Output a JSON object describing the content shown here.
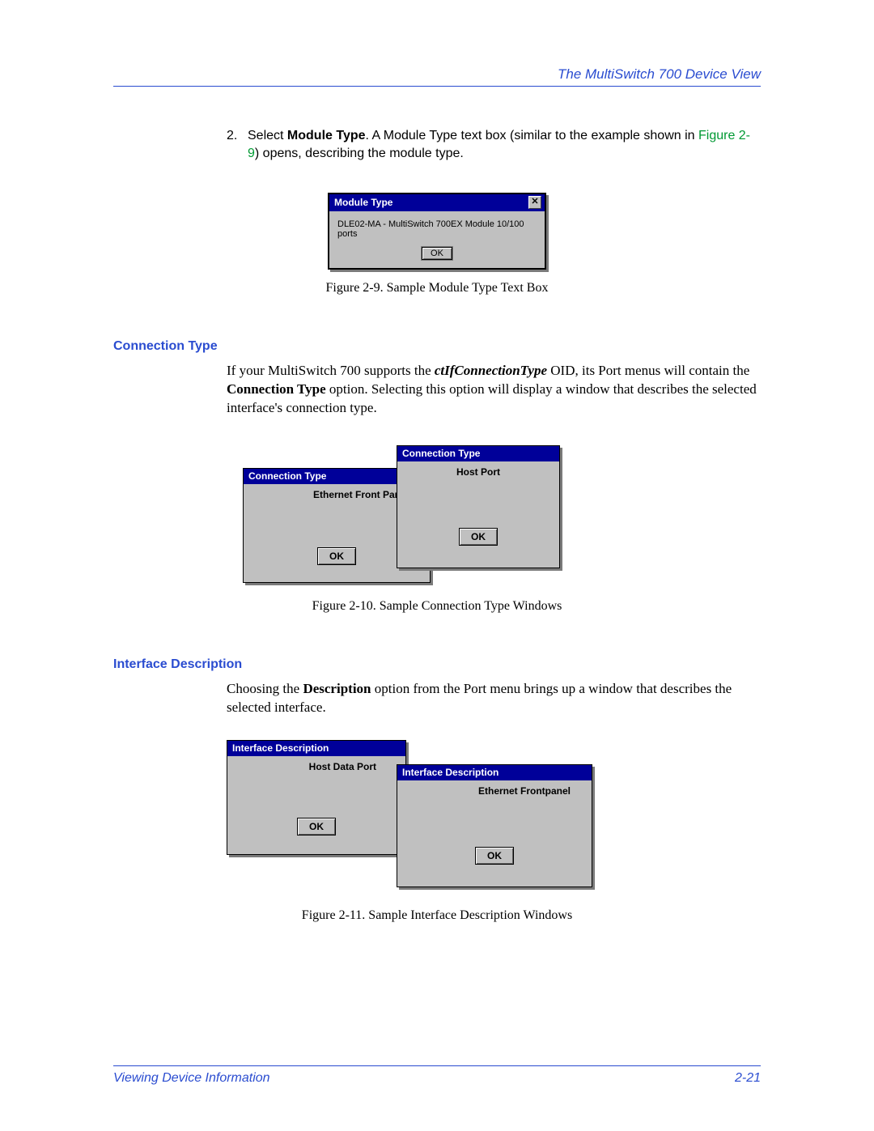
{
  "header": {
    "title": "The MultiSwitch 700 Device View"
  },
  "step": {
    "number": "2.",
    "pre": "Select ",
    "bold": "Module Type",
    "post1": ". A Module Type text box (similar to the example shown in ",
    "ref": "Figure 2-9",
    "post2": ") opens, describing the module type."
  },
  "module_window": {
    "title": "Module Type",
    "close": "✕",
    "desc": "DLE02-MA - MultiSwitch 700EX Module 10/100 ports",
    "ok": "OK"
  },
  "caption1": "Figure 2-9. Sample Module Type Text Box",
  "section1": {
    "heading": "Connection Type",
    "p1a": "If your MultiSwitch 700 supports the ",
    "p1b": "ctIfConnectionType",
    "p1c": " OID, its Port menus will contain the ",
    "p1d": "Connection Type",
    "p1e": " option. Selecting this option will display a window that describes the selected interface's connection type."
  },
  "conn_win1": {
    "title": "Connection Type",
    "label": "Ethernet Front Panel",
    "ok": "OK"
  },
  "conn_win2": {
    "title": "Connection Type",
    "label": "Host Port",
    "ok": "OK"
  },
  "caption2": "Figure 2-10. Sample Connection Type Windows",
  "section2": {
    "heading": "Interface Description",
    "p1a": "Choosing the ",
    "p1b": "Description",
    "p1c": " option from the Port menu brings up a window that describes the selected interface."
  },
  "if_win1": {
    "title": "Interface Description",
    "label": "Host Data Port",
    "ok": "OK"
  },
  "if_win2": {
    "title": "Interface Description",
    "label": "Ethernet Frontpanel",
    "ok": "OK"
  },
  "caption3": "Figure 2-11. Sample Interface Description Windows",
  "footer": {
    "left": "Viewing Device Information",
    "right": "2-21"
  }
}
